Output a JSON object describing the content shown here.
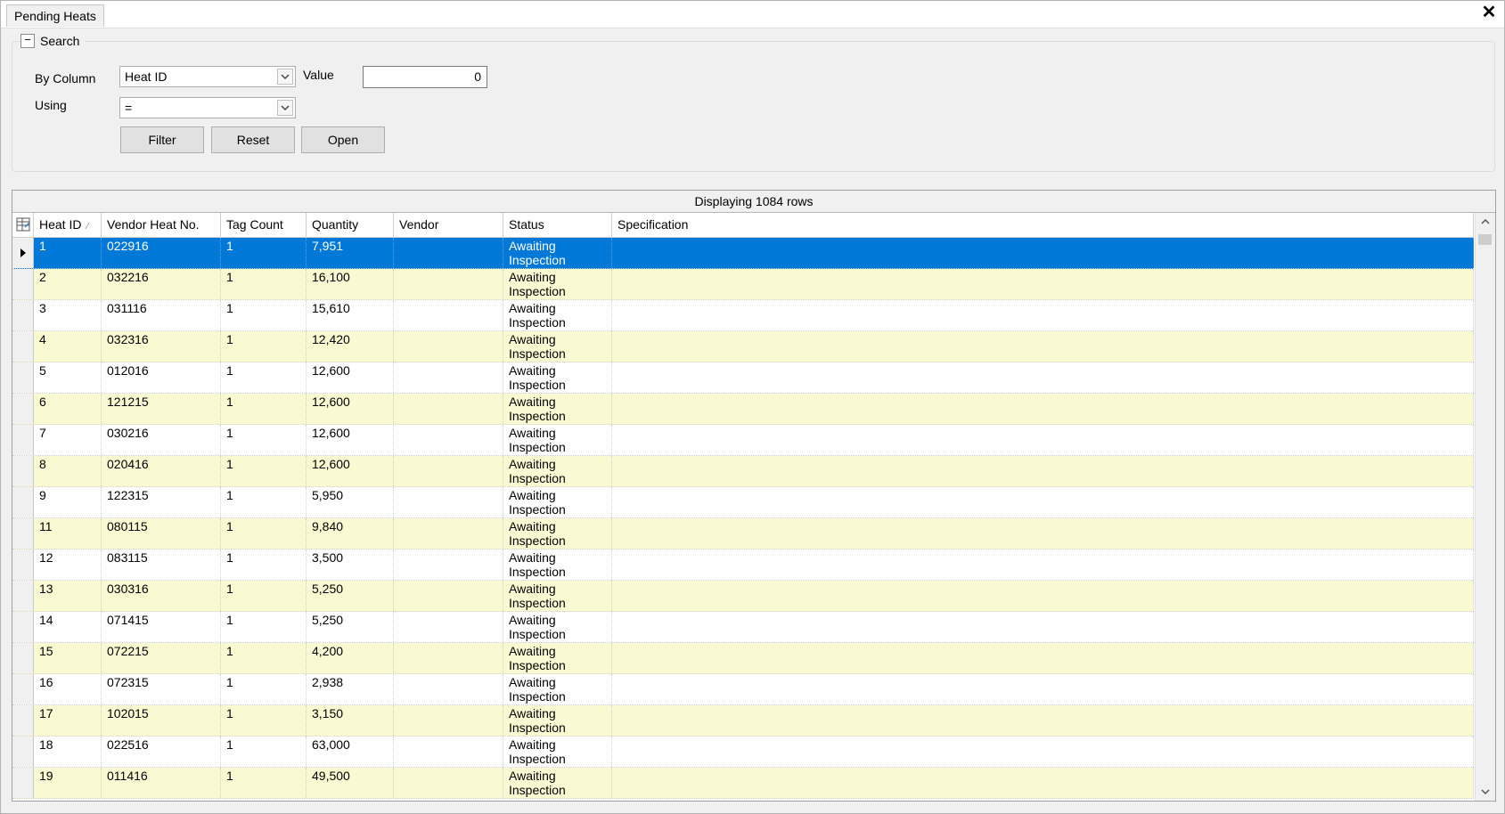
{
  "tab": {
    "label": "Pending Heats",
    "close": "✕"
  },
  "search": {
    "group_title": "Search",
    "collapse_glyph": "−",
    "by_column_label": "By Column",
    "by_column_value": "Heat ID",
    "value_label": "Value",
    "value_value": "0",
    "using_label": "Using",
    "using_value": "=",
    "filter_label": "Filter",
    "reset_label": "Reset",
    "open_label": "Open"
  },
  "grid": {
    "caption": "Displaying 1084 rows",
    "columns": [
      "Heat ID",
      "Vendor Heat No.",
      "Tag Count",
      "Quantity",
      "Vendor",
      "Status",
      "Specification"
    ],
    "sorted_column": "Heat ID",
    "selected_row_index": 0,
    "colors": {
      "selected": "#0078d7",
      "alt_row": "#fafad2"
    },
    "rows": [
      {
        "heat_id": "1",
        "vendor_heat_no": "022916",
        "tag_count": "1",
        "quantity": "7,951",
        "vendor": "",
        "status_line1": "Awaiting",
        "status_line2": "Inspection",
        "specification": ""
      },
      {
        "heat_id": "2",
        "vendor_heat_no": "032216",
        "tag_count": "1",
        "quantity": "16,100",
        "vendor": "",
        "status_line1": "Awaiting",
        "status_line2": "Inspection",
        "specification": ""
      },
      {
        "heat_id": "3",
        "vendor_heat_no": "031116",
        "tag_count": "1",
        "quantity": "15,610",
        "vendor": "",
        "status_line1": "Awaiting",
        "status_line2": "Inspection",
        "specification": ""
      },
      {
        "heat_id": "4",
        "vendor_heat_no": "032316",
        "tag_count": "1",
        "quantity": "12,420",
        "vendor": "",
        "status_line1": "Awaiting",
        "status_line2": "Inspection",
        "specification": ""
      },
      {
        "heat_id": "5",
        "vendor_heat_no": "012016",
        "tag_count": "1",
        "quantity": "12,600",
        "vendor": "",
        "status_line1": "Awaiting",
        "status_line2": "Inspection",
        "specification": ""
      },
      {
        "heat_id": "6",
        "vendor_heat_no": "121215",
        "tag_count": "1",
        "quantity": "12,600",
        "vendor": "",
        "status_line1": "Awaiting",
        "status_line2": "Inspection",
        "specification": ""
      },
      {
        "heat_id": "7",
        "vendor_heat_no": "030216",
        "tag_count": "1",
        "quantity": "12,600",
        "vendor": "",
        "status_line1": "Awaiting",
        "status_line2": "Inspection",
        "specification": ""
      },
      {
        "heat_id": "8",
        "vendor_heat_no": "020416",
        "tag_count": "1",
        "quantity": "12,600",
        "vendor": "",
        "status_line1": "Awaiting",
        "status_line2": "Inspection",
        "specification": ""
      },
      {
        "heat_id": "9",
        "vendor_heat_no": "122315",
        "tag_count": "1",
        "quantity": "5,950",
        "vendor": "",
        "status_line1": "Awaiting",
        "status_line2": "Inspection",
        "specification": ""
      },
      {
        "heat_id": "11",
        "vendor_heat_no": "080115",
        "tag_count": "1",
        "quantity": "9,840",
        "vendor": "",
        "status_line1": "Awaiting",
        "status_line2": "Inspection",
        "specification": ""
      },
      {
        "heat_id": "12",
        "vendor_heat_no": "083115",
        "tag_count": "1",
        "quantity": "3,500",
        "vendor": "",
        "status_line1": "Awaiting",
        "status_line2": "Inspection",
        "specification": ""
      },
      {
        "heat_id": "13",
        "vendor_heat_no": "030316",
        "tag_count": "1",
        "quantity": "5,250",
        "vendor": "",
        "status_line1": "Awaiting",
        "status_line2": "Inspection",
        "specification": ""
      },
      {
        "heat_id": "14",
        "vendor_heat_no": "071415",
        "tag_count": "1",
        "quantity": "5,250",
        "vendor": "",
        "status_line1": "Awaiting",
        "status_line2": "Inspection",
        "specification": ""
      },
      {
        "heat_id": "15",
        "vendor_heat_no": "072215",
        "tag_count": "1",
        "quantity": "4,200",
        "vendor": "",
        "status_line1": "Awaiting",
        "status_line2": "Inspection",
        "specification": ""
      },
      {
        "heat_id": "16",
        "vendor_heat_no": "072315",
        "tag_count": "1",
        "quantity": "2,938",
        "vendor": "",
        "status_line1": "Awaiting",
        "status_line2": "Inspection",
        "specification": ""
      },
      {
        "heat_id": "17",
        "vendor_heat_no": "102015",
        "tag_count": "1",
        "quantity": "3,150",
        "vendor": "",
        "status_line1": "Awaiting",
        "status_line2": "Inspection",
        "specification": ""
      },
      {
        "heat_id": "18",
        "vendor_heat_no": "022516",
        "tag_count": "1",
        "quantity": "63,000",
        "vendor": "",
        "status_line1": "Awaiting",
        "status_line2": "Inspection",
        "specification": ""
      },
      {
        "heat_id": "19",
        "vendor_heat_no": "011416",
        "tag_count": "1",
        "quantity": "49,500",
        "vendor": "",
        "status_line1": "Awaiting",
        "status_line2": "Inspection",
        "specification": ""
      }
    ]
  },
  "icons": {
    "column_chooser": "column-chooser-icon",
    "row_indicator": "current-row-arrow-icon",
    "dropdown": "chevron-down-icon",
    "scroll_up": "scroll-up-icon",
    "scroll_down": "scroll-down-icon"
  }
}
